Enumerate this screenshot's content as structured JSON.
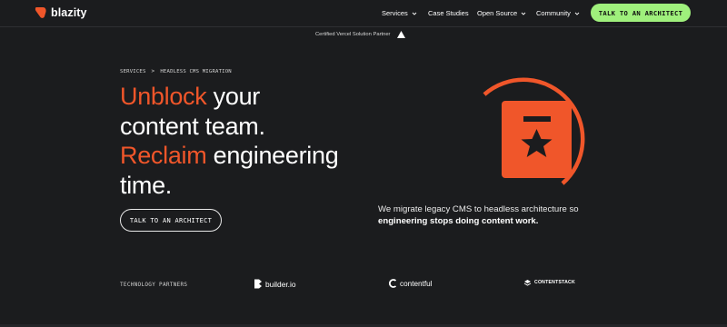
{
  "header": {
    "logo_text": "blazity",
    "nav": [
      {
        "label": "Services",
        "has_dropdown": true
      },
      {
        "label": "Case Studies",
        "has_dropdown": false
      },
      {
        "label": "Open Source",
        "has_dropdown": true
      },
      {
        "label": "Community",
        "has_dropdown": true
      }
    ],
    "cta_label": "TALK TO AN ARCHITECT"
  },
  "certified": {
    "text": "Certified Vercel Solution Partner",
    "icon": "vercel-triangle-icon"
  },
  "breadcrumb": {
    "items": [
      "SERVICES",
      "HEADLESS CMS MIGRATION"
    ],
    "separator": ">"
  },
  "hero": {
    "headline": {
      "accent_1": "Unblock",
      "rest_1": " your",
      "line_2": "content team.",
      "accent_2": "Reclaim",
      "rest_3": " engineering",
      "line_4": "time."
    },
    "cta_label": "TALK TO AN ARCHITECT",
    "description": {
      "normal": "We migrate legacy CMS to headless architecture so ",
      "bold": "engineering stops doing content work."
    },
    "illustration_icon": "document-star-icon"
  },
  "partners": {
    "label": "TECHNOLOGY PARTNERS",
    "items": [
      {
        "name": "builder.io",
        "icon": "builder-io-icon"
      },
      {
        "name": "contentful",
        "icon": "contentful-icon"
      },
      {
        "name": "CONTENTSTACK",
        "icon": "contentstack-icon"
      }
    ]
  },
  "colors": {
    "background": "#1b1c1e",
    "accent": "#f0562a",
    "cta_green": "#9ff07c",
    "text": "#ffffff"
  }
}
